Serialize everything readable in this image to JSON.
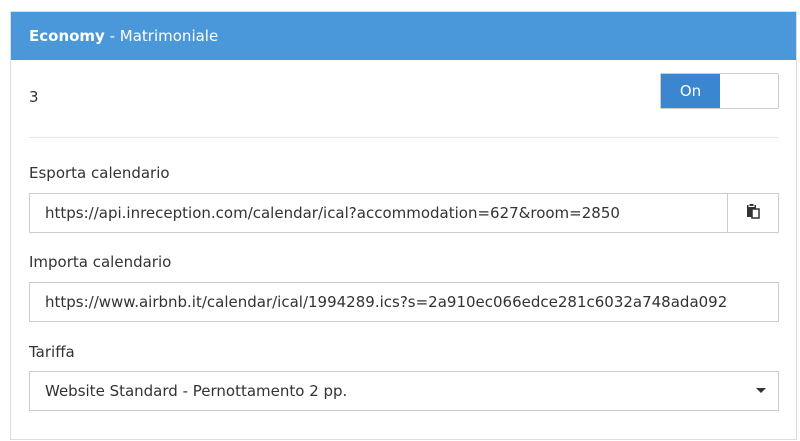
{
  "header": {
    "title_bold": "Economy",
    "title_rest": " - Matrimoniale"
  },
  "room": {
    "number": "3",
    "toggle_label": "On"
  },
  "export": {
    "label": "Esporta calendario",
    "url": "https://api.inreception.com/calendar/ical?accommodation=627&room=2850",
    "copy_icon": "clipboard-icon"
  },
  "import": {
    "label": "Importa calendario",
    "url": "https://www.airbnb.it/calendar/ical/1994289.ics?s=2a910ec066edce281c6032a748ada092"
  },
  "rate": {
    "label": "Tariffa",
    "selected": "Website Standard - Pernottamento 2 pp."
  },
  "colors": {
    "header_bg": "#4a98d9",
    "toggle_on_bg": "#3a86cf",
    "border": "#cccccc"
  }
}
